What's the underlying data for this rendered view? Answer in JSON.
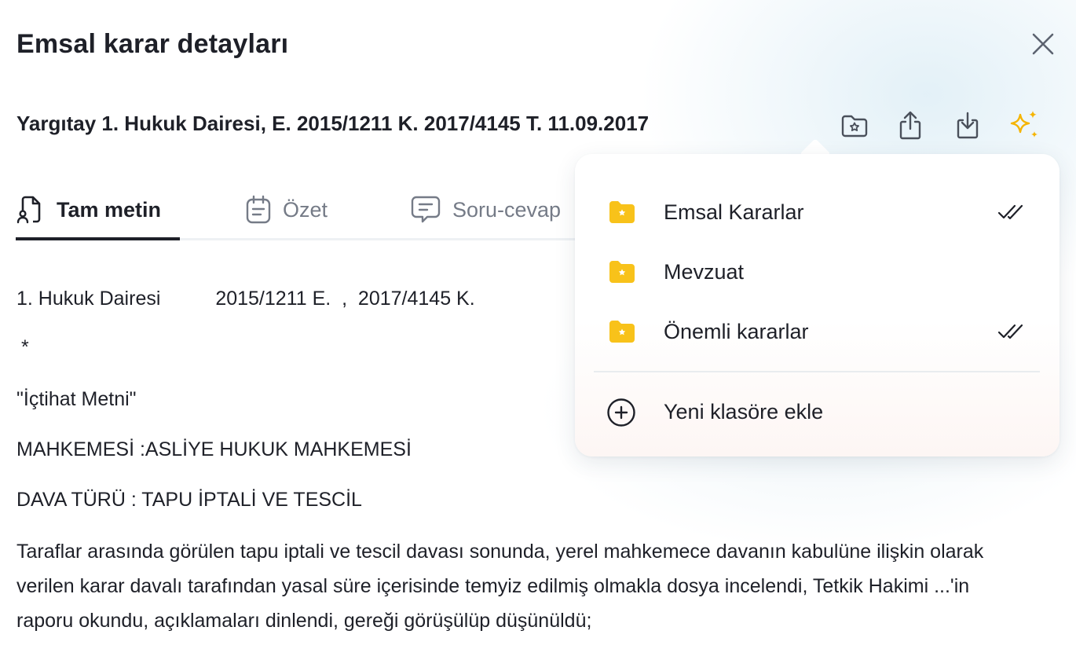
{
  "dialog": {
    "title": "Emsal karar detayları"
  },
  "decision": {
    "title": "Yargıtay 1. Hukuk Dairesi, E. 2015/1211 K. 2017/4145 T. 11.09.2017"
  },
  "toolbar": {
    "icons": [
      "folder-star-icon",
      "share-icon",
      "download-icon",
      "sparkle-icon"
    ],
    "accent_color": "#f5b400"
  },
  "tabs": [
    {
      "label": "Tam metin",
      "icon": "document-person-icon",
      "active": true
    },
    {
      "label": "Özet",
      "icon": "calendar-note-icon",
      "active": false
    },
    {
      "label": "Soru-cevap",
      "icon": "chat-bubble-icon",
      "active": false
    }
  ],
  "content": {
    "line1_chamber": "1. Hukuk Dairesi",
    "line1_numbers": "2015/1211 E.  ,  2017/4145 K.",
    "asterisk": "*",
    "heading": "\"İçtihat Metni\"",
    "court": "MAHKEMESİ :ASLİYE HUKUK MAHKEMESİ",
    "case_type": "DAVA TÜRÜ : TAPU İPTALİ VE TESCİL",
    "paragraph": "Taraflar arasında görülen tapu iptali ve tescil davası sonunda, yerel mahkemece davanın kabulüne ilişkin olarak verilen karar davalı tarafından yasal süre içerisinde temyiz edilmiş olmakla dosya incelendi, Tetkik Hakimi ...'in raporu okundu, açıklamaları dinlendi, gereği görüşülüp düşünüldü;"
  },
  "folder_menu": {
    "folder_color": "#f8c21a",
    "items": [
      {
        "label": "Emsal Kararlar",
        "checked": true
      },
      {
        "label": "Mevzuat",
        "checked": false
      },
      {
        "label": "Önemli kararlar",
        "checked": true
      }
    ],
    "new_folder_label": "Yeni klasöre ekle"
  }
}
